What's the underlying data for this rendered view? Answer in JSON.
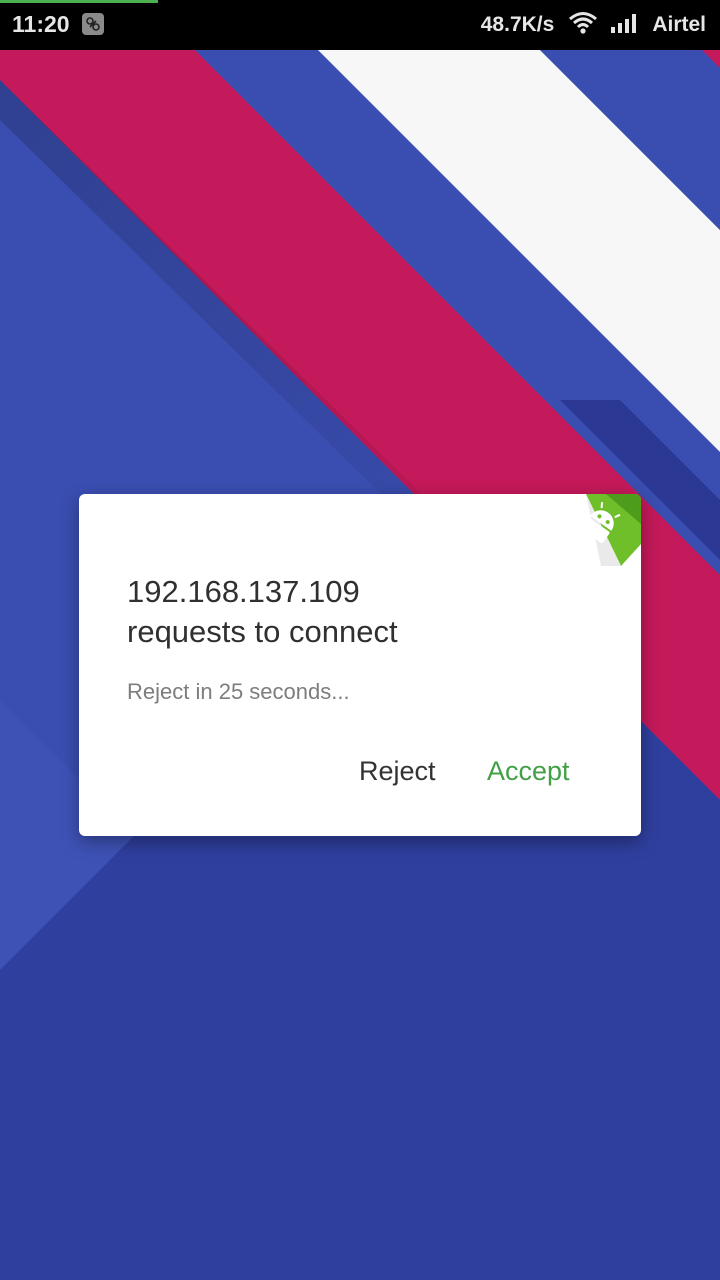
{
  "status_bar": {
    "time": "11:20",
    "network_speed": "48.7K/s",
    "carrier": "Airtel",
    "icons": [
      "notification-icon",
      "wifi-icon",
      "signal-icon"
    ],
    "progress_color": "#4caf50"
  },
  "wallpaper": {
    "colors": {
      "base": "#3a4eb1",
      "dark": "#2f3f9e",
      "stripe": "#c4195a",
      "white": "#f7f7f7"
    }
  },
  "dialog": {
    "title_line1": "192.168.137.109",
    "title_line2": "requests to connect",
    "subtitle": "Reject in 25 seconds...",
    "reject_label": "Reject",
    "accept_label": "Accept",
    "accent_color": "#43a047",
    "corner_icon": "android-icon"
  }
}
